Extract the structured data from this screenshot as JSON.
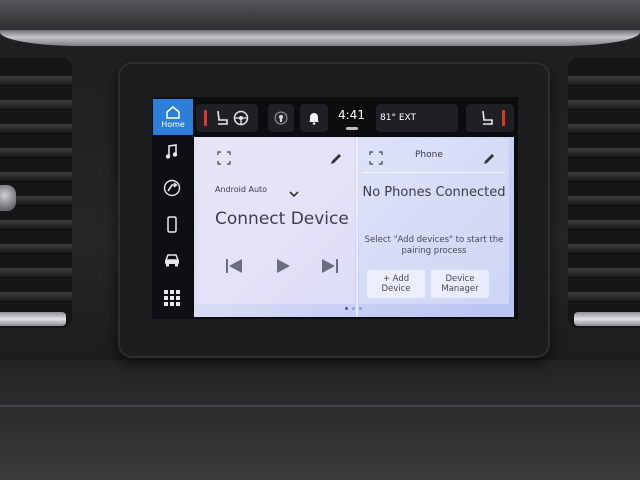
{
  "sidebar": {
    "home_label": "Home",
    "items": [
      {
        "icon": "music-note-icon"
      },
      {
        "icon": "compass-nav-icon"
      },
      {
        "icon": "phone-icon"
      },
      {
        "icon": "car-icon"
      },
      {
        "icon": "apps-grid-icon"
      }
    ]
  },
  "status_bar": {
    "time": "4:41",
    "temperature": "81° EXT"
  },
  "android_auto_card": {
    "source_label": "Android Auto",
    "title": "Connect Device"
  },
  "phone_card": {
    "title": "Phone",
    "status": "No Phones Connected",
    "instructions": "Select \"Add devices\" to start the pairing process",
    "add_device_label": "+ Add Device",
    "device_manager_label": "Device Manager"
  },
  "pagination": {
    "total_pages": 3,
    "active_page": 1
  },
  "colors": {
    "accent": "#2c7fd8",
    "alert_red": "#e0342d",
    "card_bg": "#d9dcf5"
  }
}
